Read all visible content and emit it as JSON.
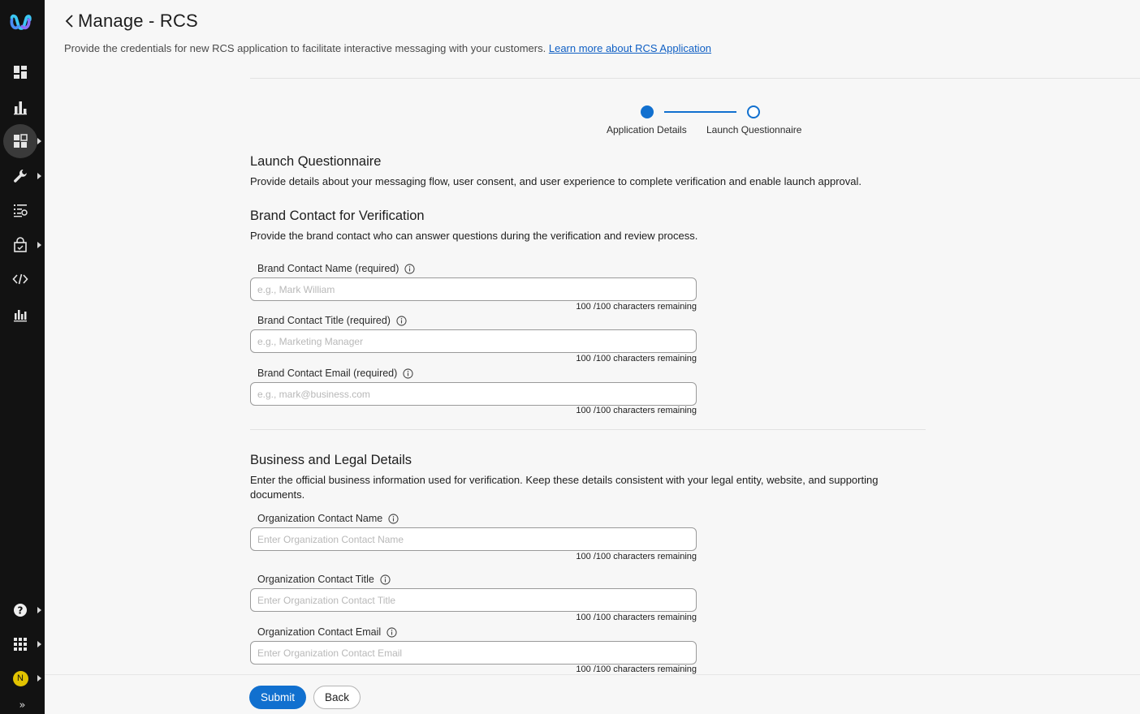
{
  "header": {
    "title": "Manage - RCS",
    "intro_text": "Provide the credentials for new RCS application to facilitate interactive messaging with your customers.",
    "learn_more_link": "Learn more about RCS Application"
  },
  "stepper": {
    "steps": [
      {
        "label": "Application Details",
        "state": "completed"
      },
      {
        "label": "Launch Questionnaire",
        "state": "current"
      }
    ]
  },
  "launch": {
    "title": "Launch Questionnaire",
    "description": "Provide details about your messaging flow, user consent, and user experience to complete verification and enable launch approval."
  },
  "brand": {
    "title": "Brand Contact for Verification",
    "description": "Provide the brand contact who can answer questions during the verification and review process.",
    "fields": [
      {
        "label": "Brand Contact Name (required)",
        "placeholder": "e.g., Mark William",
        "counter": "100 /100 characters remaining"
      },
      {
        "label": "Brand Contact Title (required)",
        "placeholder": "e.g., Marketing Manager",
        "counter": "100 /100 characters remaining"
      },
      {
        "label": "Brand Contact Email (required)",
        "placeholder": "e.g., mark@business.com",
        "counter": "100 /100 characters remaining"
      }
    ]
  },
  "business": {
    "title": "Business and Legal Details",
    "description": "Enter the official business information used for verification. Keep these details consistent with your legal entity, website, and supporting documents.",
    "fields": [
      {
        "label": "Organization Contact Name",
        "placeholder": "Enter Organization Contact Name",
        "counter": "100 /100 characters remaining"
      },
      {
        "label": "Organization Contact Title",
        "placeholder": "Enter Organization Contact Title",
        "counter": "100 /100 characters remaining"
      },
      {
        "label": "Organization Contact Email",
        "placeholder": "Enter Organization Contact Email",
        "counter": "100 /100 characters remaining"
      }
    ]
  },
  "footer": {
    "submit_label": "Submit",
    "back_label": "Back"
  },
  "sidebar": {
    "items": [
      {
        "icon": "dashboard-icon"
      },
      {
        "icon": "analytics-icon"
      },
      {
        "icon": "apps-grid-icon",
        "active": true
      },
      {
        "icon": "wrench-icon"
      },
      {
        "icon": "list-search-icon"
      },
      {
        "icon": "shop-icon"
      },
      {
        "icon": "code-icon"
      },
      {
        "icon": "report-chart-icon"
      }
    ],
    "bottom_items": [
      {
        "icon": "help-icon"
      },
      {
        "icon": "app-launcher-icon"
      },
      {
        "icon": "avatar",
        "initial": "N"
      }
    ],
    "expand_glyph": "»"
  },
  "colors": {
    "accent": "#1170cf",
    "sidebar_bg": "#121212",
    "avatar_bg": "#e2c300",
    "link": "#0f5fc4"
  }
}
